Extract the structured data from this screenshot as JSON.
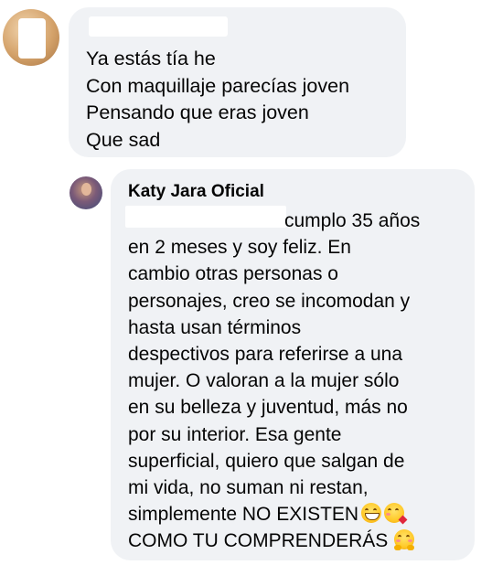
{
  "comment": {
    "lines": [
      "Ya estás tía he",
      "Con maquillaje parecías joven",
      "Pensando que eras joven",
      "Que sad"
    ]
  },
  "reply": {
    "author": "Katy Jara Oficial",
    "lines": [
      "cumplo 35 años",
      "en 2 meses y soy feliz. En",
      "cambio otras personas o",
      "personajes, creo se incomodan y",
      "hasta usan términos",
      "despectivos para referirse a una",
      "mujer. O valoran a la mujer sólo",
      "en su belleza y juventud, más no",
      "por su interior. Esa gente",
      "superficial, quiero que salgan de",
      "mi vida, no suman ni restan,",
      "simplemente NO EXISTEN",
      "COMO TU COMPRENDERÁS"
    ],
    "emojis": {
      "line12": [
        "grinning-face-emoji",
        "face-blowing-kiss-emoji"
      ],
      "line13": [
        "hugging-face-emoji"
      ]
    }
  }
}
